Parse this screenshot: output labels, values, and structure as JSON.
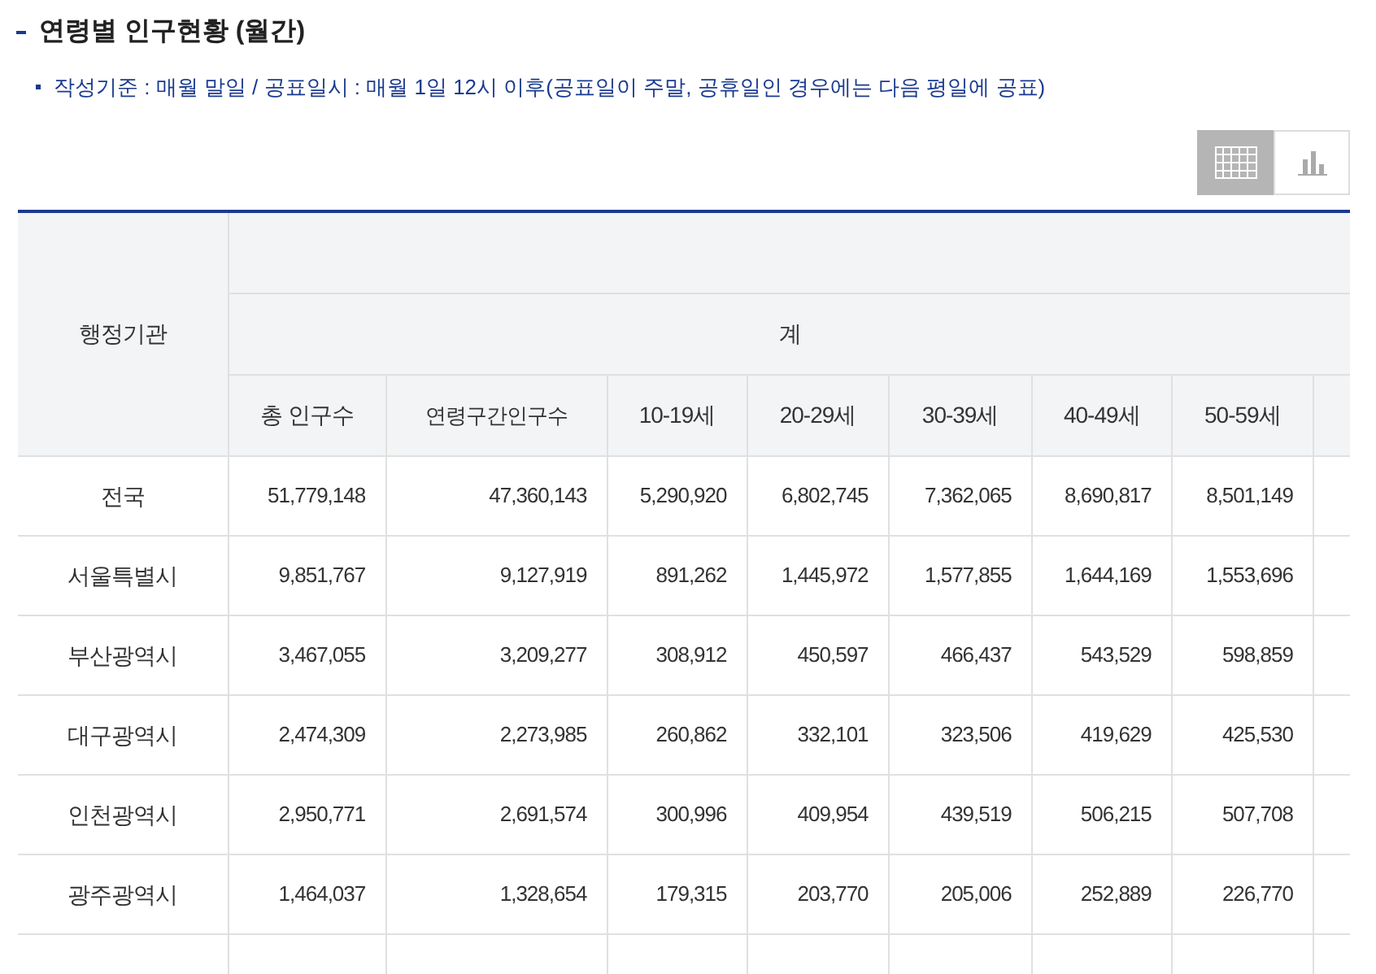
{
  "title": "연령별 인구현황 (월간)",
  "note": "작성기준 : 매월 말일 / 공표일시 : 매월 1일 12시 이후(공표일이 주말, 공휴일인 경우에는 다음 평일에 공표)",
  "view_toggle": [
    {
      "kind": "table",
      "selected": true
    },
    {
      "kind": "chart",
      "selected": false
    }
  ],
  "table": {
    "row_header": "행정기관",
    "group_header": "계",
    "columns": [
      "총 인구수",
      "연령구간인구수",
      "10-19세",
      "20-29세",
      "30-39세",
      "40-49세",
      "50-59세"
    ],
    "rows": [
      {
        "name": "전국",
        "values": [
          "51,779,148",
          "47,360,143",
          "5,290,920",
          "6,802,745",
          "7,362,065",
          "8,690,817",
          "8,501,149"
        ]
      },
      {
        "name": "서울특별시",
        "values": [
          "9,851,767",
          "9,127,919",
          "891,262",
          "1,445,972",
          "1,577,855",
          "1,644,169",
          "1,553,696"
        ]
      },
      {
        "name": "부산광역시",
        "values": [
          "3,467,055",
          "3,209,277",
          "308,912",
          "450,597",
          "466,437",
          "543,529",
          "598,859"
        ]
      },
      {
        "name": "대구광역시",
        "values": [
          "2,474,309",
          "2,273,985",
          "260,862",
          "332,101",
          "323,506",
          "419,629",
          "425,530"
        ]
      },
      {
        "name": "인천광역시",
        "values": [
          "2,950,771",
          "2,691,574",
          "300,996",
          "409,954",
          "439,519",
          "506,215",
          "507,708"
        ]
      },
      {
        "name": "광주광역시",
        "values": [
          "1,464,037",
          "1,328,654",
          "179,315",
          "203,770",
          "205,006",
          "252,889",
          "226,770"
        ]
      }
    ]
  }
}
